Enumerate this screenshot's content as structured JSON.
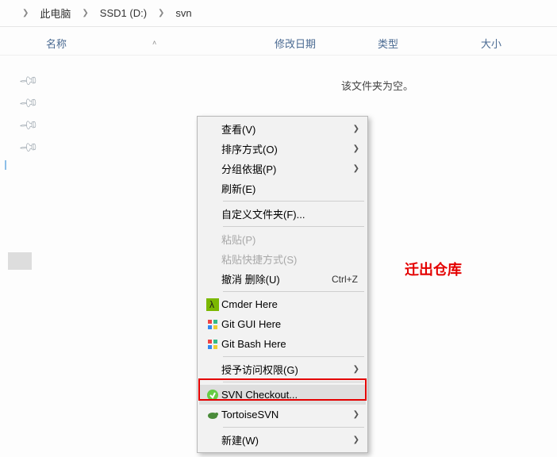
{
  "breadcrumb": {
    "l1": "此电脑",
    "l2": "SSD1 (D:)",
    "l3": "svn"
  },
  "columns": {
    "name": "名称",
    "date": "修改日期",
    "type": "类型",
    "size": "大小"
  },
  "empty_message": "该文件夹为空。",
  "annotation": "迁出仓库",
  "menu": {
    "view": {
      "label": "查看(V)"
    },
    "sort": {
      "label": "排序方式(O)"
    },
    "group": {
      "label": "分组依据(P)"
    },
    "refresh": {
      "label": "刷新(E)"
    },
    "customize": {
      "label": "自定义文件夹(F)..."
    },
    "paste": {
      "label": "粘贴(P)"
    },
    "paste_short": {
      "label": "粘贴快捷方式(S)"
    },
    "undo": {
      "label": "撤消 删除(U)",
      "accel": "Ctrl+Z"
    },
    "cmder": {
      "label": "Cmder Here"
    },
    "gitgui": {
      "label": "Git GUI Here"
    },
    "gitbash": {
      "label": "Git Bash Here"
    },
    "grant": {
      "label": "授予访问权限(G)"
    },
    "svncheckout": {
      "label": "SVN Checkout..."
    },
    "tortoise": {
      "label": "TortoiseSVN"
    },
    "new": {
      "label": "新建(W)"
    }
  }
}
